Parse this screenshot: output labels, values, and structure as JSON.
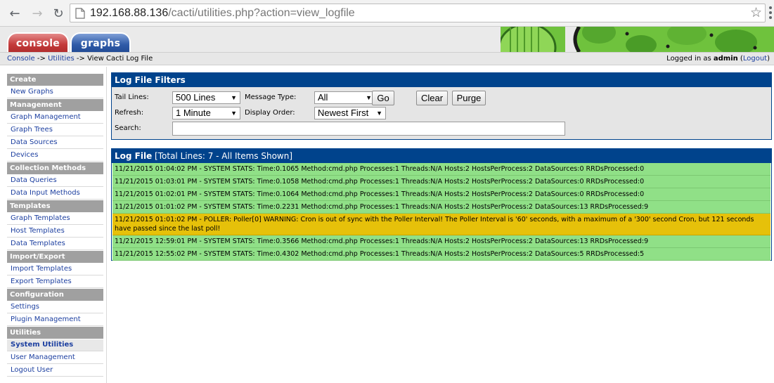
{
  "browser": {
    "url_host": "192.168.88.136",
    "url_path": "/cacti/utilities.php?action=view_logfile"
  },
  "header": {
    "tabs": [
      "console",
      "graphs"
    ]
  },
  "breadcrumb": {
    "console": "Console",
    "sep1": " -> ",
    "utilities": "Utilities",
    "sep2": " -> ",
    "current": "View Cacti Log File"
  },
  "login": {
    "prefix": "Logged in as ",
    "user": "admin",
    "open": " (",
    "logout": "Logout",
    "close": ")"
  },
  "sidebar": {
    "create": "Create",
    "new_graphs": "New Graphs",
    "management": "Management",
    "graph_management": "Graph Management",
    "graph_trees": "Graph Trees",
    "data_sources": "Data Sources",
    "devices": "Devices",
    "collection_methods": "Collection Methods",
    "data_queries": "Data Queries",
    "data_input_methods": "Data Input Methods",
    "templates": "Templates",
    "graph_templates": "Graph Templates",
    "host_templates": "Host Templates",
    "data_templates": "Data Templates",
    "import_export": "Import/Export",
    "import_templates": "Import Templates",
    "export_templates": "Export Templates",
    "configuration": "Configuration",
    "settings": "Settings",
    "plugin_management": "Plugin Management",
    "utilities": "Utilities",
    "system_utilities": "System Utilities",
    "user_management": "User Management",
    "logout_user": "Logout User"
  },
  "filters": {
    "title": "Log File Filters",
    "tail_lines_label": "Tail Lines:",
    "tail_lines_value": "500 Lines",
    "message_type_label": "Message Type:",
    "message_type_value": "All",
    "refresh_label": "Refresh:",
    "refresh_value": "1 Minute",
    "display_order_label": "Display Order:",
    "display_order_value": "Newest First",
    "search_label": "Search:",
    "search_value": "",
    "go": "Go",
    "clear": "Clear",
    "purge": "Purge"
  },
  "logfile": {
    "title": "Log File",
    "summary": " [Total Lines: 7 - All Items Shown]",
    "rows": [
      "11/21/2015 01:04:02 PM - SYSTEM STATS: Time:0.1065 Method:cmd.php Processes:1 Threads:N/A Hosts:2 HostsPerProcess:2 DataSources:0 RRDsProcessed:0",
      "11/21/2015 01:03:01 PM - SYSTEM STATS: Time:0.1058 Method:cmd.php Processes:1 Threads:N/A Hosts:2 HostsPerProcess:2 DataSources:0 RRDsProcessed:0",
      "11/21/2015 01:02:01 PM - SYSTEM STATS: Time:0.1064 Method:cmd.php Processes:1 Threads:N/A Hosts:2 HostsPerProcess:2 DataSources:0 RRDsProcessed:0",
      "11/21/2015 01:01:02 PM - SYSTEM STATS: Time:0.2231 Method:cmd.php Processes:1 Threads:N/A Hosts:2 HostsPerProcess:2 DataSources:13 RRDsProcessed:9",
      "11/21/2015 01:01:02 PM - POLLER: Poller[0] WARNING: Cron is out of sync with the Poller Interval! The Poller Interval is '60' seconds, with a maximum of a '300' second Cron, but 121 seconds have passed since the last poll!",
      "11/21/2015 12:59:01 PM - SYSTEM STATS: Time:0.3566 Method:cmd.php Processes:1 Threads:N/A Hosts:2 HostsPerProcess:2 DataSources:13 RRDsProcessed:9",
      "11/21/2015 12:55:02 PM - SYSTEM STATS: Time:0.4302 Method:cmd.php Processes:1 Threads:N/A Hosts:2 HostsPerProcess:2 DataSources:5 RRDsProcessed:5"
    ]
  },
  "colors": {
    "panel_header": "#00438c",
    "row_ok": "#90e087",
    "row_warning": "#e6c10a",
    "link": "#1c3fa0"
  }
}
